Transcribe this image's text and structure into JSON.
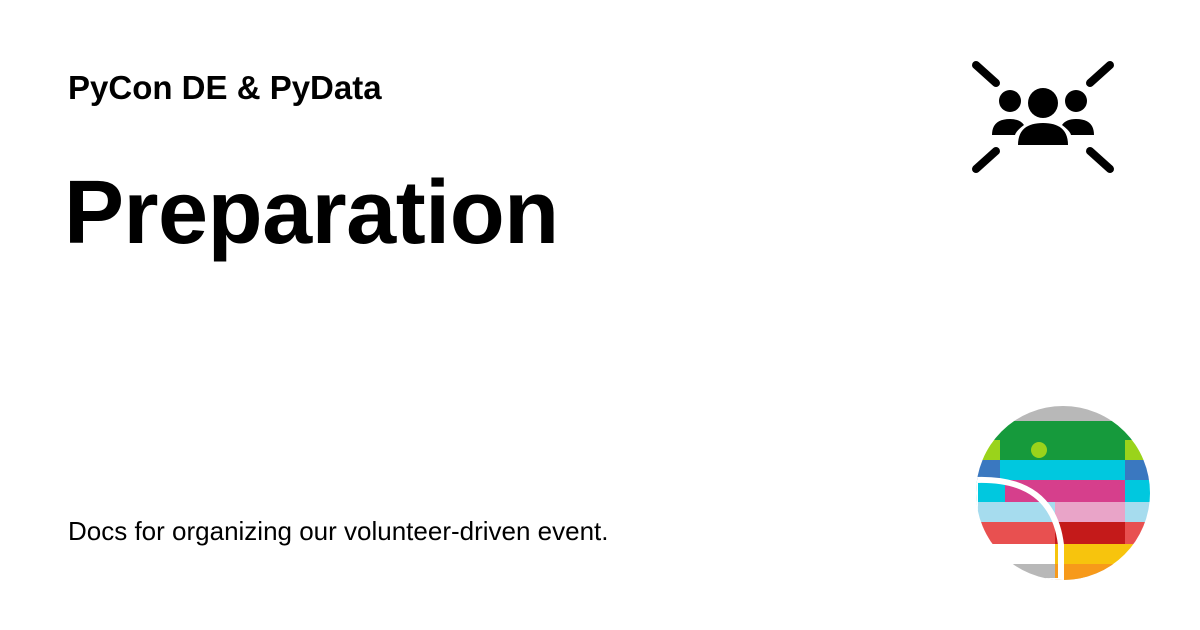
{
  "header": {
    "site_name": "PyCon DE & PyData"
  },
  "main": {
    "title": "Preparation",
    "description": "Docs for organizing our volunteer-driven event."
  },
  "icons": {
    "people": "people-group-icon",
    "logo": "pycon-de-logo"
  },
  "colors": {
    "text": "#000000",
    "background": "#ffffff",
    "logo_bands": [
      "#b8b8b8",
      "#169a3c",
      "#9ad31b",
      "#3a78c0",
      "#00c8df",
      "#d63f8c",
      "#a6dcee",
      "#e9a4c8",
      "#e85050",
      "#c41a1a",
      "#f7c40d",
      "#f79a1a"
    ]
  }
}
